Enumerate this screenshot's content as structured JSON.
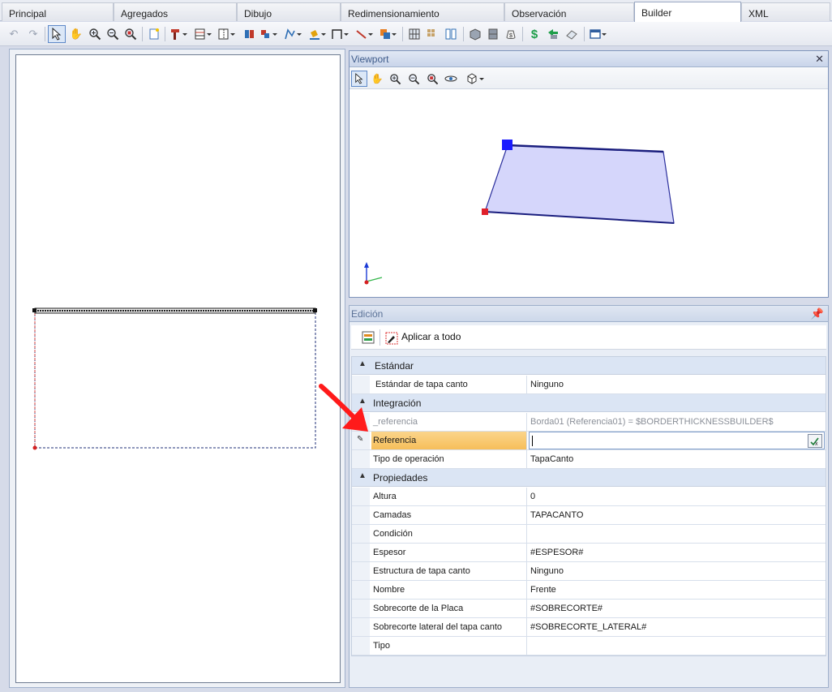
{
  "tabs": [
    {
      "label": "Principal",
      "active": false
    },
    {
      "label": "Agregados",
      "active": false
    },
    {
      "label": "Dibujo",
      "active": false
    },
    {
      "label": "Redimensionamiento",
      "active": false
    },
    {
      "label": "Observación",
      "active": false
    },
    {
      "label": "Builder",
      "active": true
    },
    {
      "label": "XML",
      "active": false
    }
  ],
  "viewport": {
    "title": "Viewport",
    "close_glyph": "✕"
  },
  "edicion": {
    "title": "Edición",
    "apply_label": "Aplicar a todo",
    "categories": {
      "estandar": "Estándar",
      "integracion": "Integración",
      "propiedades": "Propiedades"
    },
    "rows": {
      "estandar_tapa": {
        "label": "Estándar de tapa canto",
        "value": "Ninguno"
      },
      "ref_old": {
        "label": "_referencia",
        "value": "Borda01 (Referencia01) = $BORDERTHICKNESSBUILDER$"
      },
      "referencia": {
        "label": "Referencia",
        "value": ""
      },
      "tipo_operacion": {
        "label": "Tipo de operación",
        "value": "TapaCanto"
      },
      "altura": {
        "label": "Altura",
        "value": "0"
      },
      "camadas": {
        "label": "Camadas",
        "value": "TAPACANTO"
      },
      "condicion": {
        "label": "Condición",
        "value": ""
      },
      "espesor": {
        "label": "Espesor",
        "value": "#ESPESOR#"
      },
      "estructura": {
        "label": "Estructura de tapa canto",
        "value": "Ninguno"
      },
      "nombre": {
        "label": "Nombre",
        "value": "Frente"
      },
      "sobrecorte_placa": {
        "label": "Sobrecorte de la Placa",
        "value": "#SOBRECORTE#"
      },
      "sobrecorte_lateral": {
        "label": "Sobrecorte lateral del tapa canto",
        "value": "#SOBRECORTE_LATERAL#"
      },
      "tipo": {
        "label": "Tipo",
        "value": ""
      }
    }
  },
  "colors": {
    "accent_selection": "#f6be5a",
    "shape_fill": "#d5d6fb",
    "handle_blue": "#1a1aff",
    "handle_red": "#e0202a",
    "annotation_arrow": "#ff1a1a"
  },
  "icons": [
    "undo-icon",
    "redo-icon",
    "pointer-icon",
    "pan-icon",
    "zoom-in-icon",
    "zoom-out-icon",
    "zoom-fit-icon",
    "new-icon",
    "tool-icon",
    "layout-icon",
    "align-icon",
    "stack-icon",
    "palette-icon",
    "path-icon",
    "bucket-icon",
    "dimension-icon",
    "line-icon",
    "color-icon",
    "grid-icon",
    "columns-icon",
    "split-icon",
    "box-icon",
    "cabinet-icon",
    "money-bag-icon",
    "dollar-icon",
    "arrows-icon",
    "eraser-icon",
    "window-icon"
  ]
}
